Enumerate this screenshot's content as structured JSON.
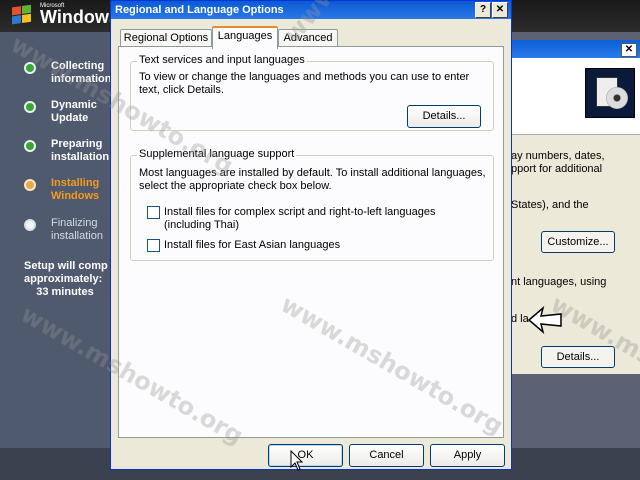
{
  "setup": {
    "logo_small": "Microsoft",
    "logo_text": "Windows",
    "steps": [
      {
        "label": "Collecting\ninformation",
        "state": "done"
      },
      {
        "label": "Dynamic\nUpdate",
        "state": "done"
      },
      {
        "label": "Preparing\ninstallation",
        "state": "done"
      },
      {
        "label": "Installing\nWindows",
        "state": "current"
      },
      {
        "label": "Finalizing\ninstallation",
        "state": "pending"
      }
    ],
    "estimate": "Setup will comp\napproximately:\n    33 minutes"
  },
  "behind_window": {
    "close_glyph": "✕",
    "text_1": "ay numbers, dates,\npport for additional",
    "text_2": "States), and the",
    "customize_label": "Customize...",
    "text_3": "nt languages, using",
    "text_4": "d la",
    "details_label": "Details..."
  },
  "dialog": {
    "title": "Regional and Language Options",
    "help_glyph": "?",
    "close_glyph": "✕",
    "tabs": [
      {
        "label": "Regional Options",
        "active": false
      },
      {
        "label": "Languages",
        "active": true
      },
      {
        "label": "Advanced",
        "active": false
      }
    ],
    "text_services": {
      "title": "Text services and input languages",
      "description": "To view or change the languages and methods you can use to enter\ntext, click Details.",
      "details_label": "Details..."
    },
    "supplemental": {
      "title": "Supplemental language support",
      "description": "Most languages are installed by default. To install additional languages,\nselect the appropriate check box below.",
      "checkbox_complex": {
        "label": "Install files for complex script and right-to-left languages\n(including Thai)",
        "checked": false
      },
      "checkbox_east_asian": {
        "label": "Install files for East Asian languages",
        "checked": false
      }
    },
    "buttons": {
      "ok": "OK",
      "cancel": "Cancel",
      "apply": "Apply"
    }
  },
  "watermark_text": "www.mshowto.org"
}
